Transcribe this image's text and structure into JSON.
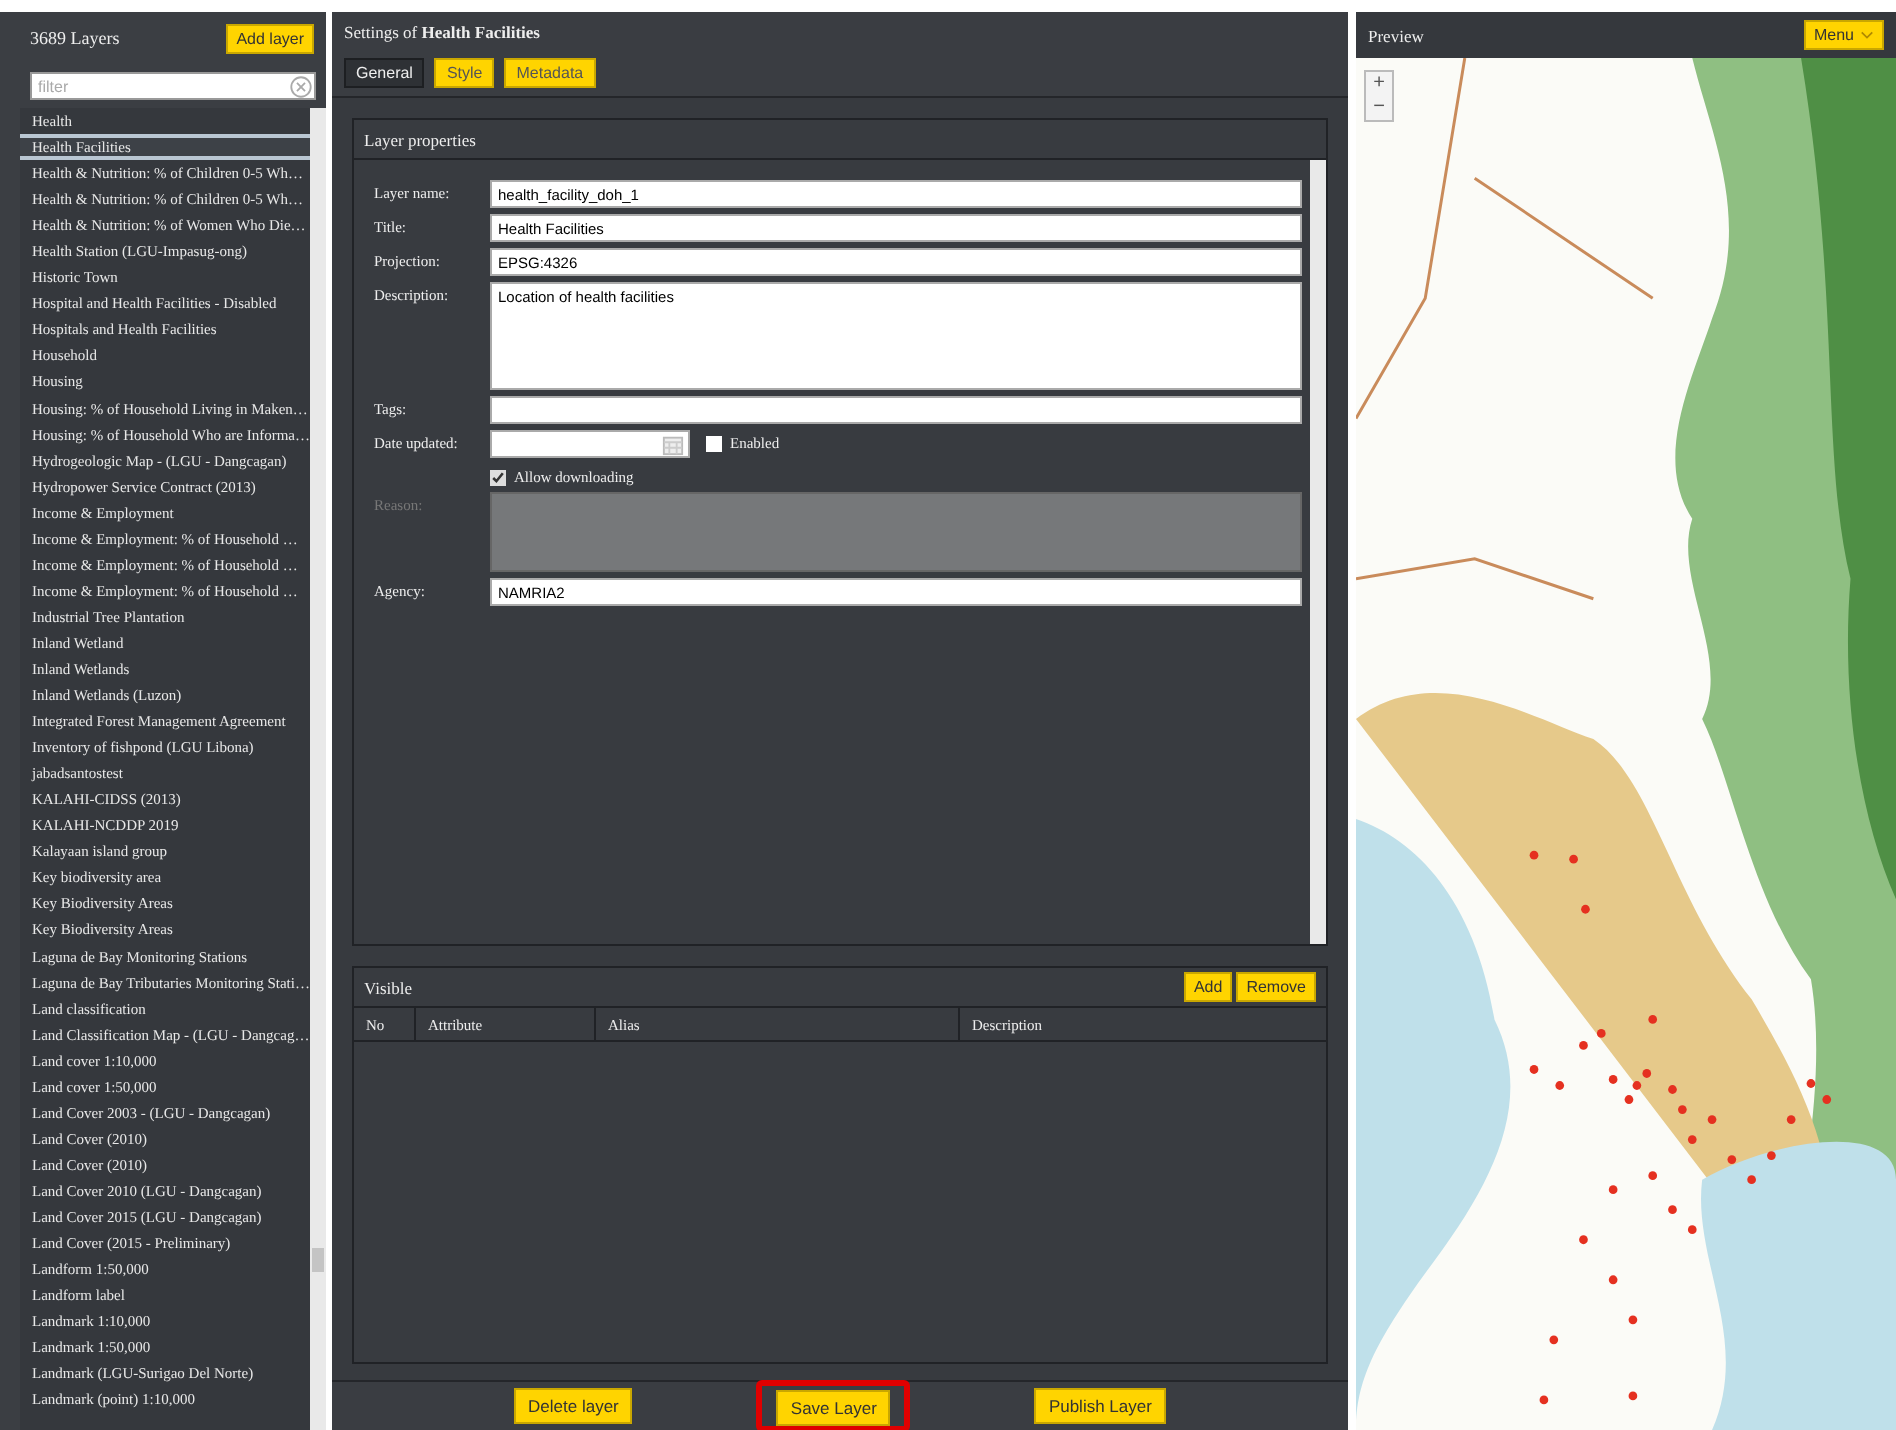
{
  "layers_panel": {
    "count_label": "3689 Layers",
    "add_button": "Add layer",
    "filter": {
      "placeholder": "filter"
    },
    "items": [
      {
        "label": "Health",
        "selected": false
      },
      {
        "label": "Health Facilities",
        "selected": true
      },
      {
        "label": "Health & Nutrition: % of Children 0-5 Wh…",
        "selected": false
      },
      {
        "label": "Health & Nutrition: % of Children 0-5 Wh…",
        "selected": false
      },
      {
        "label": "Health & Nutrition: % of Women Who Die…",
        "selected": false
      },
      {
        "label": "Health Station (LGU-Impasug-ong)",
        "selected": false
      },
      {
        "label": "Historic Town",
        "selected": false
      },
      {
        "label": "Hospital and Health Facilities - Disabled",
        "selected": false
      },
      {
        "label": "Hospitals and Health Facilities",
        "selected": false
      },
      {
        "label": "Household",
        "selected": false
      },
      {
        "label": "Housing",
        "selected": false
      },
      {
        "label": "Housing: % of Household Living in Maken…",
        "selected": false
      },
      {
        "label": "Housing: % of Household Who are Informa…",
        "selected": false
      },
      {
        "label": "Hydrogeologic Map - (LGU - Dangcagan)",
        "selected": false
      },
      {
        "label": "Hydropower Service Contract (2013)",
        "selected": false
      },
      {
        "label": "Income & Employment",
        "selected": false
      },
      {
        "label": "Income & Employment: % of Household …",
        "selected": false
      },
      {
        "label": "Income & Employment: % of Household …",
        "selected": false
      },
      {
        "label": "Income & Employment: % of Household …",
        "selected": false
      },
      {
        "label": "Industrial Tree Plantation",
        "selected": false
      },
      {
        "label": "Inland Wetland",
        "selected": false
      },
      {
        "label": "Inland Wetlands",
        "selected": false
      },
      {
        "label": "Inland Wetlands (Luzon)",
        "selected": false
      },
      {
        "label": "Integrated Forest Management Agreement",
        "selected": false
      },
      {
        "label": "Inventory of fishpond (LGU Libona)",
        "selected": false
      },
      {
        "label": "jabadsantostest",
        "selected": false
      },
      {
        "label": "KALAHI-CIDSS (2013)",
        "selected": false
      },
      {
        "label": "KALAHI-NCDDP 2019",
        "selected": false
      },
      {
        "label": "Kalayaan island group",
        "selected": false
      },
      {
        "label": "Key biodiversity area",
        "selected": false
      },
      {
        "label": "Key Biodiversity Areas",
        "selected": false
      },
      {
        "label": "Key Biodiversity Areas",
        "selected": false
      },
      {
        "label": "Laguna de Bay Monitoring Stations",
        "selected": false
      },
      {
        "label": "Laguna de Bay Tributaries Monitoring Stati…",
        "selected": false
      },
      {
        "label": "Land classification",
        "selected": false
      },
      {
        "label": "Land Classification Map - (LGU - Dangcag…",
        "selected": false
      },
      {
        "label": "Land cover 1:10,000",
        "selected": false
      },
      {
        "label": "Land cover 1:50,000",
        "selected": false
      },
      {
        "label": "Land Cover 2003 - (LGU - Dangcagan)",
        "selected": false
      },
      {
        "label": "Land Cover (2010)",
        "selected": false
      },
      {
        "label": "Land Cover (2010)",
        "selected": false
      },
      {
        "label": "Land Cover 2010 (LGU - Dangcagan)",
        "selected": false
      },
      {
        "label": "Land Cover 2015 (LGU - Dangcagan)",
        "selected": false
      },
      {
        "label": "Land Cover (2015 - Preliminary)",
        "selected": false
      },
      {
        "label": "Landform 1:50,000",
        "selected": false
      },
      {
        "label": "Landform label",
        "selected": false
      },
      {
        "label": "Landmark 1:10,000",
        "selected": false
      },
      {
        "label": "Landmark 1:50,000",
        "selected": false
      },
      {
        "label": "Landmark (LGU-Surigao Del Norte)",
        "selected": false
      },
      {
        "label": "Landmark (point) 1:10,000",
        "selected": false
      }
    ]
  },
  "settings": {
    "title_prefix": "Settings of ",
    "title_name": "Health Facilities",
    "tabs": [
      {
        "label": "General",
        "selected": true
      },
      {
        "label": "Style",
        "selected": false
      },
      {
        "label": "Metadata",
        "selected": false
      }
    ],
    "properties": {
      "title": "Layer properties",
      "fields": [
        {
          "kind": "text",
          "label": "Layer name:",
          "value": "health_facility_doh_1"
        },
        {
          "kind": "text",
          "label": "Title:",
          "value": "Health Facilities"
        },
        {
          "kind": "text",
          "label": "Projection:",
          "value": "EPSG:4326"
        },
        {
          "kind": "textarea",
          "label": "Description:",
          "value": "Location of health facilities"
        },
        {
          "kind": "text",
          "label": "Tags:"
        },
        {
          "kind": "date",
          "label": "Date updated:",
          "checkbox": {
            "label": "Enabled",
            "checked": false
          }
        },
        {
          "kind": "checkbox",
          "label": "Allow downloading",
          "checked": true
        },
        {
          "kind": "textarea",
          "label": "Reason:",
          "disabled": true
        },
        {
          "kind": "text",
          "label": "Agency:",
          "value": "NAMRIA2"
        }
      ]
    },
    "visible": {
      "title": "Visible",
      "buttons": [
        "Add",
        "Remove"
      ],
      "columns": [
        "No",
        "Attribute",
        "Alias",
        "Description"
      ]
    },
    "actions": [
      {
        "label": "Delete layer",
        "highlighted": false
      },
      {
        "label": "Save Layer",
        "highlighted": true
      },
      {
        "label": "Publish Layer",
        "highlighted": false
      }
    ]
  },
  "preview": {
    "title": "Preview",
    "menu_button": "Menu",
    "zoom_in": "+",
    "zoom_out": "−"
  }
}
